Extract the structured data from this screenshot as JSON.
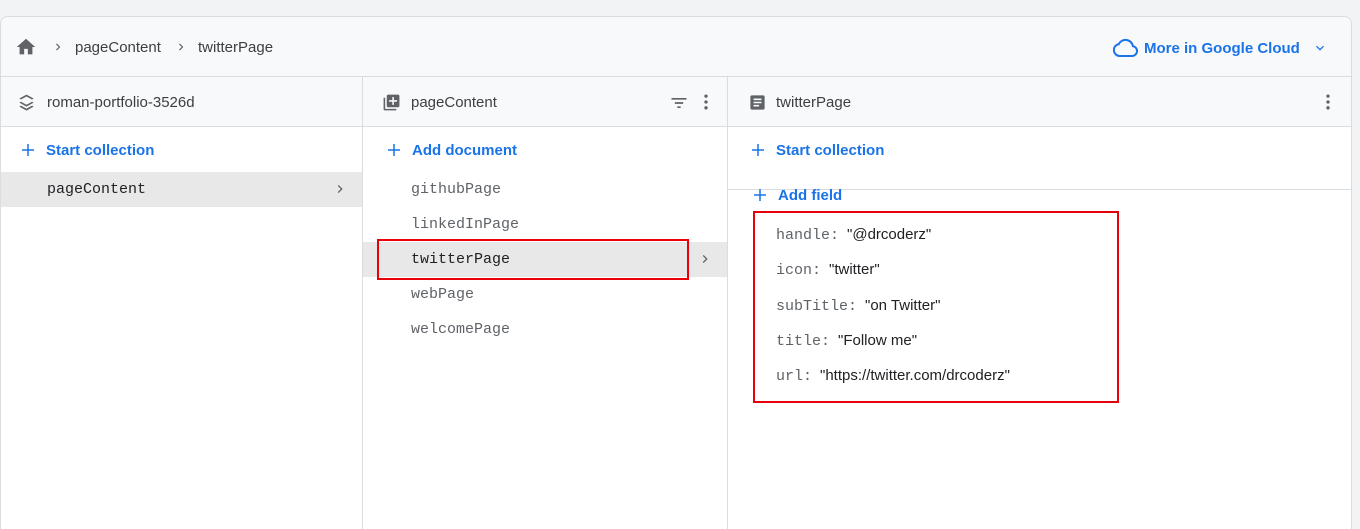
{
  "breadcrumb": {
    "items": [
      "pageContent",
      "twitterPage"
    ]
  },
  "google_cloud_link": "More in Google Cloud",
  "columns": {
    "root": {
      "title": "roman-portfolio-3526d",
      "action": "Start collection",
      "items": [
        {
          "label": "pageContent",
          "selected": true
        }
      ]
    },
    "collection": {
      "title": "pageContent",
      "action": "Add document",
      "items": [
        {
          "label": "githubPage"
        },
        {
          "label": "linkedInPage"
        },
        {
          "label": "twitterPage",
          "selected": true
        },
        {
          "label": "webPage"
        },
        {
          "label": "welcomePage"
        }
      ]
    },
    "document": {
      "title": "twitterPage",
      "action_collection": "Start collection",
      "action_field": "Add field",
      "fields": [
        {
          "key": "handle:",
          "value": "\"@drcoderz\""
        },
        {
          "key": "icon:",
          "value": "\"twitter\""
        },
        {
          "key": "subTitle:",
          "value": "\"on Twitter\""
        },
        {
          "key": "title:",
          "value": "\"Follow me\""
        },
        {
          "key": "url:",
          "value": "\"https://twitter.com/drcoderz\""
        }
      ]
    }
  },
  "colors": {
    "accent": "#1a73e8",
    "highlight_box": "#e8000b",
    "selected_row": "#e8e8e8"
  },
  "icons": [
    "home-icon",
    "chevron-right-icon",
    "cloud-icon",
    "chevron-down-icon",
    "firestore-icon",
    "collection-icon",
    "filter-icon",
    "more-vert-icon",
    "document-icon",
    "plus-icon"
  ]
}
